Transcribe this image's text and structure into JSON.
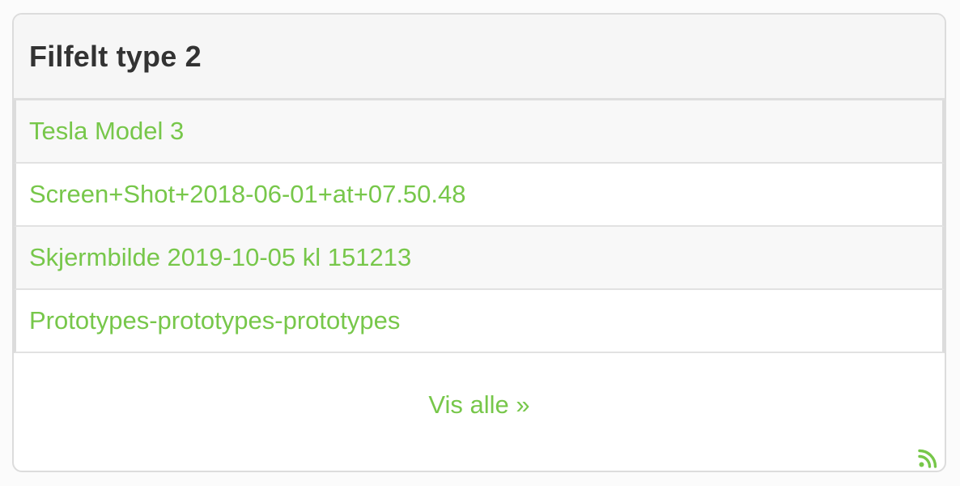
{
  "panel": {
    "title": "Filfelt type 2"
  },
  "files": [
    {
      "name": "Tesla Model 3"
    },
    {
      "name": "Screen+Shot+2018-06-01+at+07.50.48"
    },
    {
      "name": "Skjermbilde 2019-10-05 kl 151213"
    },
    {
      "name": "Prototypes-prototypes-prototypes"
    }
  ],
  "footer": {
    "show_all_label": "Vis alle »",
    "feed_icon": "rss-icon"
  },
  "colors": {
    "link": "#77c74a",
    "header_bg": "#f6f6f6",
    "title": "#333333",
    "border": "#dcdcdc"
  }
}
